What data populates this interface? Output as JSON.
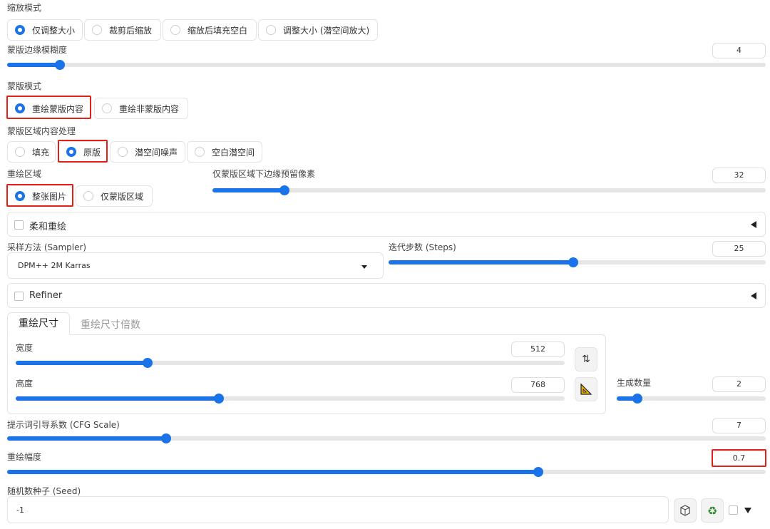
{
  "resize_mode": {
    "label": "缩放模式",
    "options": [
      "仅调整大小",
      "裁剪后缩放",
      "缩放后填充空白",
      "调整大小 (潜空间放大)"
    ],
    "selected": 0
  },
  "mask_blur": {
    "label": "蒙版边缘模糊度",
    "value": "4",
    "fraction": 0.07
  },
  "mask_mode": {
    "label": "蒙版模式",
    "options": [
      "重绘蒙版内容",
      "重绘非蒙版内容"
    ],
    "selected": 0
  },
  "masked_content": {
    "label": "蒙版区域内容处理",
    "options": [
      "填充",
      "原版",
      "潜空间噪声",
      "空白潜空间"
    ],
    "selected": 1
  },
  "inpaint_area": {
    "label": "重绘区域",
    "options": [
      "整张图片",
      "仅蒙版区域"
    ],
    "selected": 0
  },
  "only_masked_padding": {
    "label": "仅蒙版区域下边缘预留像素",
    "value": "32",
    "fraction": 0.13
  },
  "soft_inpaint": {
    "label": "柔和重绘"
  },
  "sampler": {
    "label": "采样方法 (Sampler)",
    "value": "DPM++ 2M Karras"
  },
  "steps": {
    "label": "迭代步数 (Steps)",
    "value": "25",
    "fraction": 0.49
  },
  "refiner": {
    "label": "Refiner"
  },
  "tabs": [
    "重绘尺寸",
    "重绘尺寸倍数"
  ],
  "width": {
    "label": "宽度",
    "value": "512",
    "fraction": 0.24
  },
  "height": {
    "label": "高度",
    "value": "768",
    "fraction": 0.37
  },
  "batch_size": {
    "label": "生成数量",
    "value": "2",
    "fraction": 0.14
  },
  "cfg_scale": {
    "label": "提示词引导系数 (CFG Scale)",
    "value": "7",
    "fraction": 0.21
  },
  "denoise": {
    "label": "重绘幅度",
    "value": "0.7",
    "fraction": 0.7
  },
  "seed": {
    "label": "随机数种子 (Seed)",
    "value": "-1"
  },
  "colors": {
    "accent": "#1a73e8",
    "highlight": "#e0201a"
  }
}
